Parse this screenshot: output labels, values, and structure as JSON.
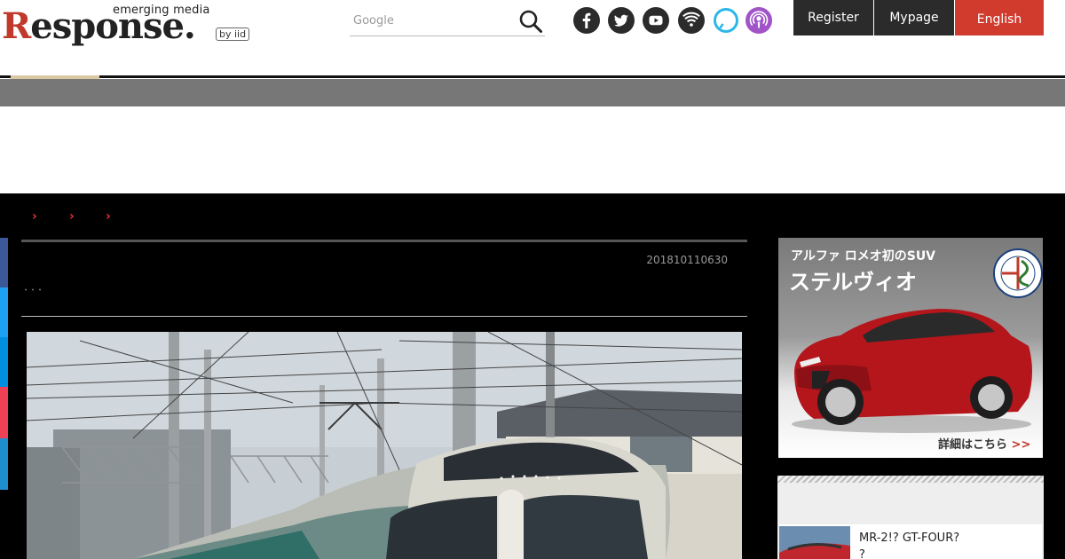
{
  "header": {
    "logo_tagline": "emerging media",
    "logo_word": "esponse.",
    "logo_letter": "R",
    "logo_by": "by iid",
    "search_placeholder": "Google",
    "social_icons": [
      "facebook-icon",
      "twitter-icon",
      "youtube-icon",
      "rss-icon",
      "alexa-icon",
      "podcast-icon"
    ],
    "register_label": "Register",
    "mypage_label": "Mypage",
    "english_label": "English"
  },
  "breadcrumb": {
    "separators": [
      "›",
      "›",
      "›"
    ]
  },
  "article": {
    "date": "201810110630",
    "meta_dots": "･･･"
  },
  "sidebar": {
    "ad": {
      "line1": "アルファ ロメオ初のSUV",
      "line2": "ステルヴィオ",
      "cta": "詳細はこちら",
      "cta_arrow": ">>"
    },
    "ranking": {
      "item_title_1": "MR-2!? GT-FOUR?",
      "item_title_2": "?"
    }
  },
  "colors": {
    "accent_red": "#c0392b",
    "english_button": "#d03b2e",
    "dark_button": "#2b2b2b",
    "share_facebook": "#3b5998",
    "share_twitter": "#1da1f2",
    "share_hatena": "#008fde",
    "share_pocket": "#ef4056",
    "share_line": "#1d8ece"
  }
}
